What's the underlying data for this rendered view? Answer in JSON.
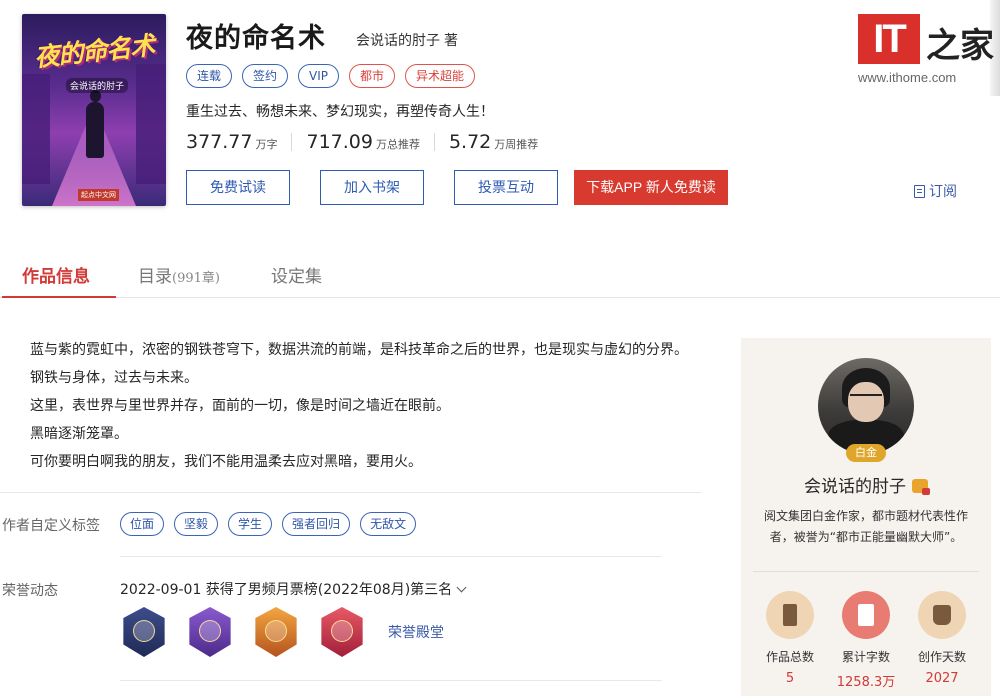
{
  "book": {
    "cover_title": "夜的命名术",
    "cover_author": "会说话的肘子",
    "cover_publisher": "起点中文网",
    "title": "夜的命名术",
    "author": "会说话的肘子",
    "author_suffix": "著",
    "tags": [
      "连载",
      "签约",
      "VIP",
      "都市",
      "异术超能"
    ],
    "intro": "重生过去、畅想未来、梦幻现实，再塑传奇人生！",
    "stats": [
      {
        "value": "377.77",
        "unit": "万字"
      },
      {
        "value": "717.09",
        "unit": "万总推荐"
      },
      {
        "value": "5.72",
        "unit": "万周推荐"
      }
    ],
    "actions": {
      "read": "免费试读",
      "shelf": "加入书架",
      "vote": "投票互动",
      "download": "下载APP 新人免费读"
    },
    "subscribe": "订阅"
  },
  "watermark": {
    "logo": "IT",
    "name": "之家",
    "url": "www.ithome.com"
  },
  "tabs": [
    {
      "label": "作品信息",
      "count": ""
    },
    {
      "label": "目录",
      "count": "(991章)"
    },
    {
      "label": "设定集",
      "count": ""
    }
  ],
  "description": [
    "蓝与紫的霓虹中，浓密的钢铁苍穹下，数据洪流的前端，是科技革命之后的世界，也是现实与虚幻的分界。",
    "钢铁与身体，过去与未来。",
    "这里，表世界与里世界并存，面前的一切，像是时间之墙近在眼前。",
    "黑暗逐渐笼罩。",
    "可你要明白啊我的朋友，我们不能用温柔去应对黑暗，要用火。"
  ],
  "custom_tags": {
    "label": "作者自定义标签",
    "items": [
      "位面",
      "坚毅",
      "学生",
      "强者回归",
      "无敌文"
    ]
  },
  "honors": {
    "label": "荣誉动态",
    "text": "2022-09-01 获得了男频月票榜(2022年08月)第三名",
    "badges": [
      "赛季十强",
      "百万月票",
      "5",
      "年度作品"
    ],
    "hall": "荣誉殿堂"
  },
  "author_card": {
    "level": "白金",
    "name": "会说话的肘子",
    "bio": "阅文集团白金作家，都市题材代表性作者，被誉为“都市正能量幽默大师”。",
    "stats": [
      {
        "label": "作品总数",
        "value": "5"
      },
      {
        "label": "累计字数",
        "value": "1258.3万"
      },
      {
        "label": "创作天数",
        "value": "2027"
      }
    ]
  }
}
